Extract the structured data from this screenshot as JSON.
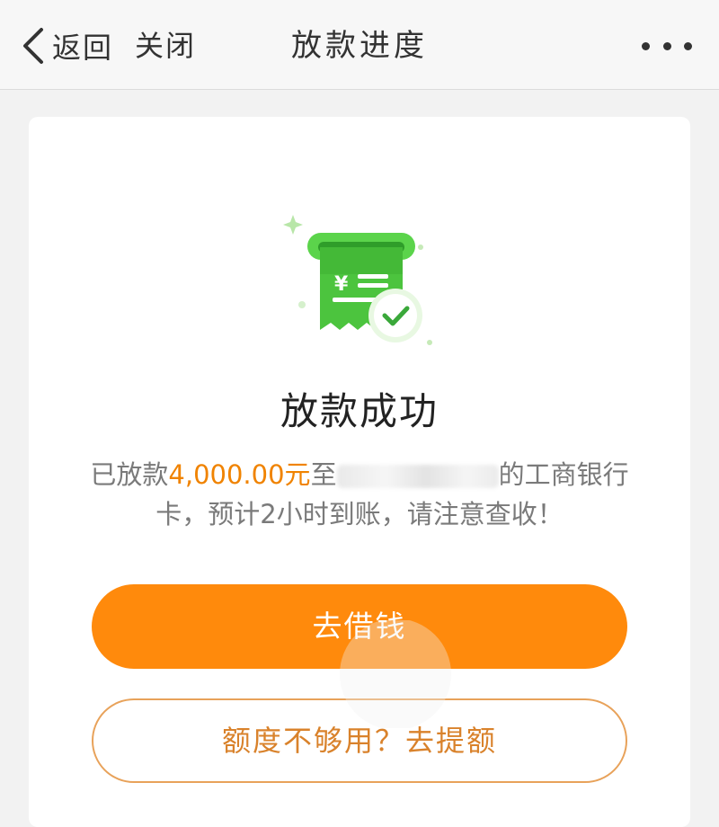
{
  "nav": {
    "back_label": "返回",
    "close_label": "关闭",
    "title": "放款进度"
  },
  "status": {
    "title": "放款成功",
    "desc_prefix": "已放款",
    "amount": "4,000.00元",
    "desc_to": "至",
    "desc_suffix_line1": "的工商银行",
    "desc_line2": "卡，预计2小时到账，请注意查收！"
  },
  "actions": {
    "primary_label": "去借钱",
    "secondary_label": "额度不够用？去提额"
  },
  "colors": {
    "accent": "#ff8a0c",
    "amount": "#f08300",
    "success_green": "#4cc43e"
  },
  "icons": {
    "back": "chevron-left-icon",
    "more": "more-dots-icon",
    "illustration": "receipt-success-icon"
  }
}
